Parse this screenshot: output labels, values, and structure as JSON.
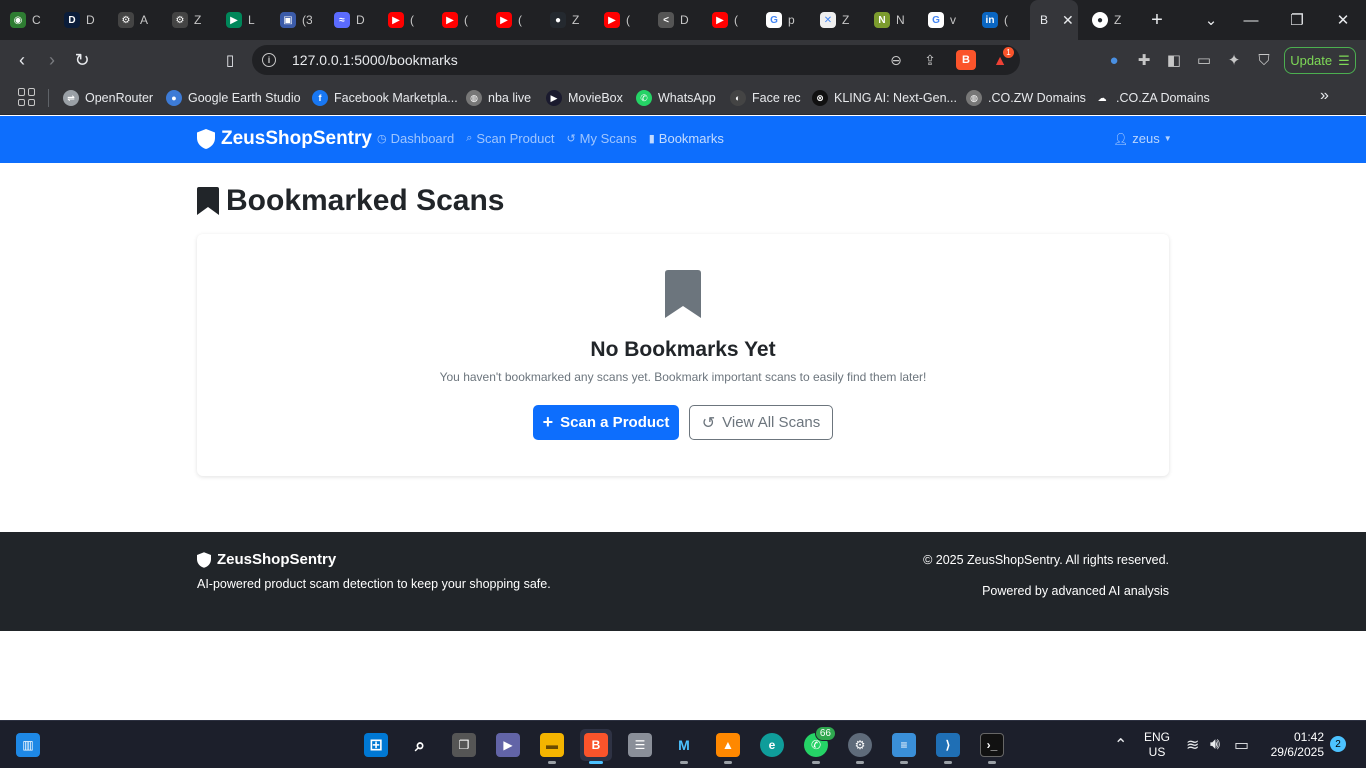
{
  "browser": {
    "tabs": [
      {
        "title": "C",
        "icon": "colorful-logo-icon",
        "color": "#2e7d32",
        "glyph": "◉"
      },
      {
        "title": "D",
        "icon": "d-logo-icon",
        "color": "#0b1d3a",
        "glyph": "D"
      },
      {
        "title": "A",
        "icon": "openai-icon",
        "color": "#444",
        "glyph": "⚙"
      },
      {
        "title": "Z",
        "icon": "openai-icon",
        "color": "#444",
        "glyph": "⚙"
      },
      {
        "title": "L",
        "icon": "play-logo-icon",
        "color": "#00875a",
        "glyph": "▶"
      },
      {
        "title": "(3",
        "icon": "window-icon",
        "color": "#3b5ba9",
        "glyph": "▣"
      },
      {
        "title": "D",
        "icon": "devin-icon",
        "color": "#5b6bff",
        "glyph": "≈"
      },
      {
        "title": "(",
        "icon": "youtube-icon",
        "color": "#ff0000",
        "glyph": "▶"
      },
      {
        "title": "(",
        "icon": "youtube-icon",
        "color": "#ff0000",
        "glyph": "▶"
      },
      {
        "title": "(",
        "icon": "youtube-icon",
        "color": "#ff0000",
        "glyph": "▶"
      },
      {
        "title": "Z",
        "icon": "github-icon",
        "color": "#24292f",
        "glyph": "●"
      },
      {
        "title": "(",
        "icon": "youtube-icon",
        "color": "#ff0000",
        "glyph": "▶"
      },
      {
        "title": "D",
        "icon": "share-icon",
        "color": "#555",
        "glyph": "<"
      },
      {
        "title": "(",
        "icon": "youtube-icon",
        "color": "#ff0000",
        "glyph": "▶"
      },
      {
        "title": "p",
        "icon": "google-icon",
        "color": "#fff",
        "glyph": "G"
      },
      {
        "title": "Z",
        "icon": "diagram-icon",
        "color": "#eee",
        "glyph": "✕"
      },
      {
        "title": "N",
        "icon": "n-logo-icon",
        "color": "#7c9c2e",
        "glyph": "N"
      },
      {
        "title": "v",
        "icon": "google-icon",
        "color": "#fff",
        "glyph": "G"
      },
      {
        "title": "(",
        "icon": "linkedin-icon",
        "color": "#0a66c2",
        "glyph": "in"
      }
    ],
    "active_tab": {
      "title": "B"
    },
    "last_tab": {
      "title": "Z",
      "icon": "github-icon"
    },
    "url": "127.0.0.1:5000/bookmarks",
    "rewards_badge": "1",
    "update_label": "Update"
  },
  "bookmarks_bar": [
    {
      "label": "OpenRouter",
      "icon": "openrouter-icon",
      "color": "#9aa0a6",
      "glyph": "⇌"
    },
    {
      "label": "Google Earth Studio",
      "icon": "globe-icon",
      "color": "#3d7bd6",
      "glyph": "●"
    },
    {
      "label": "Facebook Marketpla...",
      "icon": "facebook-icon",
      "color": "#1877f2",
      "glyph": "f"
    },
    {
      "label": "nba live",
      "icon": "globe-icon",
      "color": "#777",
      "glyph": "◍"
    },
    {
      "label": "MovieBox",
      "icon": "moviebox-icon",
      "color": "#1a1a2e",
      "glyph": "▶"
    },
    {
      "label": "WhatsApp",
      "icon": "whatsapp-icon",
      "color": "#25d366",
      "glyph": "✆"
    },
    {
      "label": "Face rec",
      "icon": "face-rec-icon",
      "color": "#444",
      "glyph": "◐"
    },
    {
      "label": "KLING AI: Next-Gen...",
      "icon": "kling-icon",
      "color": "#111",
      "glyph": "⊗"
    },
    {
      "label": ".CO.ZW Domains",
      "icon": "globe-icon",
      "color": "#777",
      "glyph": "◍"
    },
    {
      "label": ".CO.ZA Domains",
      "icon": "cloud-icon",
      "color": "#35363a",
      "glyph": "☁"
    }
  ],
  "app": {
    "brand": "ZeusShopSentry",
    "nav": [
      {
        "label": "Dashboard",
        "icon": "dashboard-icon",
        "glyph": "◷"
      },
      {
        "label": "Scan Product",
        "icon": "search-icon",
        "glyph": "⌕"
      },
      {
        "label": "My Scans",
        "icon": "history-icon",
        "glyph": "↺"
      },
      {
        "label": "Bookmarks",
        "icon": "bookmark-icon",
        "glyph": "▮"
      }
    ],
    "user": "zeus"
  },
  "main": {
    "title": "Bookmarked Scans",
    "empty_title": "No Bookmarks Yet",
    "empty_text": "You haven't bookmarked any scans yet. Bookmark important scans to easily find them later!",
    "primary_button": "Scan a Product",
    "secondary_button": "View All Scans"
  },
  "footer": {
    "brand": "ZeusShopSentry",
    "tagline": "AI-powered product scam detection to keep your shopping safe.",
    "copyright": "© 2025 ZeusShopSentry. All rights reserved.",
    "powered": "Powered by advanced AI analysis"
  },
  "taskbar": {
    "whatsapp_badge": "66",
    "lang_line1": "ENG",
    "lang_line2": "US",
    "time": "01:42",
    "date": "29/6/2025",
    "notifications": "2"
  },
  "colors": {
    "primary": "#0d6efd",
    "dark": "#212529",
    "muted": "#6c757d"
  }
}
